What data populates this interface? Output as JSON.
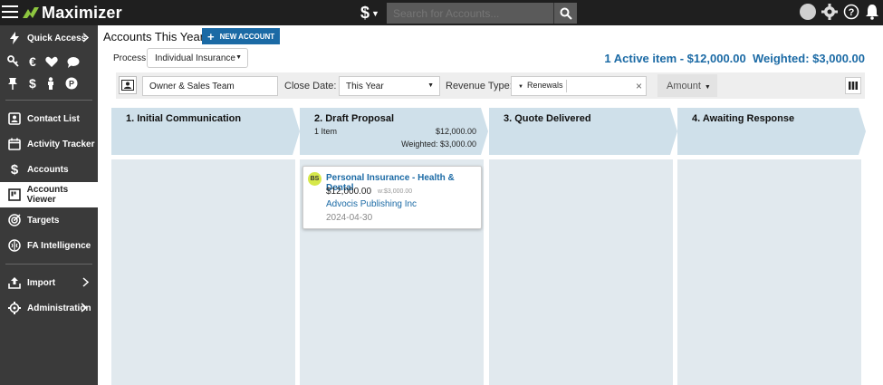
{
  "app": {
    "name": "Maximizer"
  },
  "topbar": {
    "currency_symbol": "$",
    "search_placeholder": "Search for Accounts..."
  },
  "sidebar": {
    "quick_access": "Quick Access",
    "items": [
      {
        "label": "Contact List",
        "icon": "contact-list-icon"
      },
      {
        "label": "Activity Tracker",
        "icon": "calendar-icon"
      },
      {
        "label": "Accounts",
        "icon": "dollar-icon"
      },
      {
        "label": "Accounts Viewer",
        "icon": "kanban-icon",
        "active": true
      },
      {
        "label": "Targets",
        "icon": "target-icon"
      },
      {
        "label": "FA Intelligence",
        "icon": "brain-icon"
      }
    ],
    "import": "Import",
    "administration": "Administration"
  },
  "header": {
    "title": "Accounts This Year",
    "new_account": "NEW ACCOUNT",
    "summary": "1 Active item - $12,000.00  Weighted: $3,000.00"
  },
  "process": {
    "label": "Process:",
    "value": "Individual Insurance"
  },
  "filters": {
    "owner": "Owner & Sales Team",
    "close_date_label": "Close Date:",
    "close_date_value": "This Year",
    "revenue_type_label": "Revenue Type:",
    "revenue_tag": "Renewals",
    "amount_label": "Amount"
  },
  "stages": [
    {
      "title": "1. Initial Communication"
    },
    {
      "title": "2. Draft Proposal",
      "count": "1 Item",
      "amount": "$12,000.00",
      "weighted": "Weighted: $3,000.00"
    },
    {
      "title": "3. Quote Delivered"
    },
    {
      "title": "4. Awaiting Response"
    }
  ],
  "deal": {
    "initials": "BS",
    "title": "Personal Insurance - Health & Dental",
    "amount": "$12,000.00",
    "weighted": "w:$3,000.00",
    "company": "Advocis Publishing Inc",
    "date": "2024-04-30"
  },
  "colors": {
    "accent": "#1b6aa5",
    "stage_bg": "#cfe0ea",
    "column_bg": "#e1e9ee",
    "logo_green": "#8dc63f"
  }
}
